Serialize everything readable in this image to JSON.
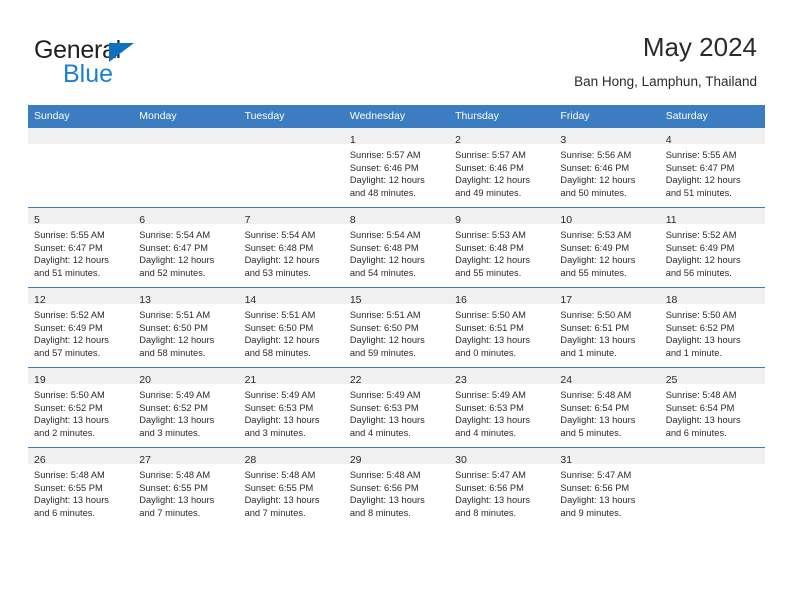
{
  "brand": {
    "name_top": "General",
    "name_bottom": "Blue",
    "triangle_color": "#0f6fc1",
    "blue_text_color": "#1b7fd4"
  },
  "header": {
    "title": "May 2024",
    "subtitle": "Ban Hong, Lamphun, Thailand"
  },
  "theme": {
    "header_bg": "#3b7dc0",
    "header_text": "#ffffff",
    "daynum_bar_bg": "#f0f0f0",
    "row_divider": "#3b7dc0",
    "body_text": "#2b2b2b"
  },
  "calendar": {
    "weekdays": [
      "Sunday",
      "Monday",
      "Tuesday",
      "Wednesday",
      "Thursday",
      "Friday",
      "Saturday"
    ],
    "weeks": [
      [
        {
          "day": "",
          "lines": []
        },
        {
          "day": "",
          "lines": []
        },
        {
          "day": "",
          "lines": []
        },
        {
          "day": "1",
          "lines": [
            "Sunrise: 5:57 AM",
            "Sunset: 6:46 PM",
            "Daylight: 12 hours",
            "and 48 minutes."
          ]
        },
        {
          "day": "2",
          "lines": [
            "Sunrise: 5:57 AM",
            "Sunset: 6:46 PM",
            "Daylight: 12 hours",
            "and 49 minutes."
          ]
        },
        {
          "day": "3",
          "lines": [
            "Sunrise: 5:56 AM",
            "Sunset: 6:46 PM",
            "Daylight: 12 hours",
            "and 50 minutes."
          ]
        },
        {
          "day": "4",
          "lines": [
            "Sunrise: 5:55 AM",
            "Sunset: 6:47 PM",
            "Daylight: 12 hours",
            "and 51 minutes."
          ]
        }
      ],
      [
        {
          "day": "5",
          "lines": [
            "Sunrise: 5:55 AM",
            "Sunset: 6:47 PM",
            "Daylight: 12 hours",
            "and 51 minutes."
          ]
        },
        {
          "day": "6",
          "lines": [
            "Sunrise: 5:54 AM",
            "Sunset: 6:47 PM",
            "Daylight: 12 hours",
            "and 52 minutes."
          ]
        },
        {
          "day": "7",
          "lines": [
            "Sunrise: 5:54 AM",
            "Sunset: 6:48 PM",
            "Daylight: 12 hours",
            "and 53 minutes."
          ]
        },
        {
          "day": "8",
          "lines": [
            "Sunrise: 5:54 AM",
            "Sunset: 6:48 PM",
            "Daylight: 12 hours",
            "and 54 minutes."
          ]
        },
        {
          "day": "9",
          "lines": [
            "Sunrise: 5:53 AM",
            "Sunset: 6:48 PM",
            "Daylight: 12 hours",
            "and 55 minutes."
          ]
        },
        {
          "day": "10",
          "lines": [
            "Sunrise: 5:53 AM",
            "Sunset: 6:49 PM",
            "Daylight: 12 hours",
            "and 55 minutes."
          ]
        },
        {
          "day": "11",
          "lines": [
            "Sunrise: 5:52 AM",
            "Sunset: 6:49 PM",
            "Daylight: 12 hours",
            "and 56 minutes."
          ]
        }
      ],
      [
        {
          "day": "12",
          "lines": [
            "Sunrise: 5:52 AM",
            "Sunset: 6:49 PM",
            "Daylight: 12 hours",
            "and 57 minutes."
          ]
        },
        {
          "day": "13",
          "lines": [
            "Sunrise: 5:51 AM",
            "Sunset: 6:50 PM",
            "Daylight: 12 hours",
            "and 58 minutes."
          ]
        },
        {
          "day": "14",
          "lines": [
            "Sunrise: 5:51 AM",
            "Sunset: 6:50 PM",
            "Daylight: 12 hours",
            "and 58 minutes."
          ]
        },
        {
          "day": "15",
          "lines": [
            "Sunrise: 5:51 AM",
            "Sunset: 6:50 PM",
            "Daylight: 12 hours",
            "and 59 minutes."
          ]
        },
        {
          "day": "16",
          "lines": [
            "Sunrise: 5:50 AM",
            "Sunset: 6:51 PM",
            "Daylight: 13 hours",
            "and 0 minutes."
          ]
        },
        {
          "day": "17",
          "lines": [
            "Sunrise: 5:50 AM",
            "Sunset: 6:51 PM",
            "Daylight: 13 hours",
            "and 1 minute."
          ]
        },
        {
          "day": "18",
          "lines": [
            "Sunrise: 5:50 AM",
            "Sunset: 6:52 PM",
            "Daylight: 13 hours",
            "and 1 minute."
          ]
        }
      ],
      [
        {
          "day": "19",
          "lines": [
            "Sunrise: 5:50 AM",
            "Sunset: 6:52 PM",
            "Daylight: 13 hours",
            "and 2 minutes."
          ]
        },
        {
          "day": "20",
          "lines": [
            "Sunrise: 5:49 AM",
            "Sunset: 6:52 PM",
            "Daylight: 13 hours",
            "and 3 minutes."
          ]
        },
        {
          "day": "21",
          "lines": [
            "Sunrise: 5:49 AM",
            "Sunset: 6:53 PM",
            "Daylight: 13 hours",
            "and 3 minutes."
          ]
        },
        {
          "day": "22",
          "lines": [
            "Sunrise: 5:49 AM",
            "Sunset: 6:53 PM",
            "Daylight: 13 hours",
            "and 4 minutes."
          ]
        },
        {
          "day": "23",
          "lines": [
            "Sunrise: 5:49 AM",
            "Sunset: 6:53 PM",
            "Daylight: 13 hours",
            "and 4 minutes."
          ]
        },
        {
          "day": "24",
          "lines": [
            "Sunrise: 5:48 AM",
            "Sunset: 6:54 PM",
            "Daylight: 13 hours",
            "and 5 minutes."
          ]
        },
        {
          "day": "25",
          "lines": [
            "Sunrise: 5:48 AM",
            "Sunset: 6:54 PM",
            "Daylight: 13 hours",
            "and 6 minutes."
          ]
        }
      ],
      [
        {
          "day": "26",
          "lines": [
            "Sunrise: 5:48 AM",
            "Sunset: 6:55 PM",
            "Daylight: 13 hours",
            "and 6 minutes."
          ]
        },
        {
          "day": "27",
          "lines": [
            "Sunrise: 5:48 AM",
            "Sunset: 6:55 PM",
            "Daylight: 13 hours",
            "and 7 minutes."
          ]
        },
        {
          "day": "28",
          "lines": [
            "Sunrise: 5:48 AM",
            "Sunset: 6:55 PM",
            "Daylight: 13 hours",
            "and 7 minutes."
          ]
        },
        {
          "day": "29",
          "lines": [
            "Sunrise: 5:48 AM",
            "Sunset: 6:56 PM",
            "Daylight: 13 hours",
            "and 8 minutes."
          ]
        },
        {
          "day": "30",
          "lines": [
            "Sunrise: 5:47 AM",
            "Sunset: 6:56 PM",
            "Daylight: 13 hours",
            "and 8 minutes."
          ]
        },
        {
          "day": "31",
          "lines": [
            "Sunrise: 5:47 AM",
            "Sunset: 6:56 PM",
            "Daylight: 13 hours",
            "and 9 minutes."
          ]
        },
        {
          "day": "",
          "lines": []
        }
      ]
    ]
  }
}
